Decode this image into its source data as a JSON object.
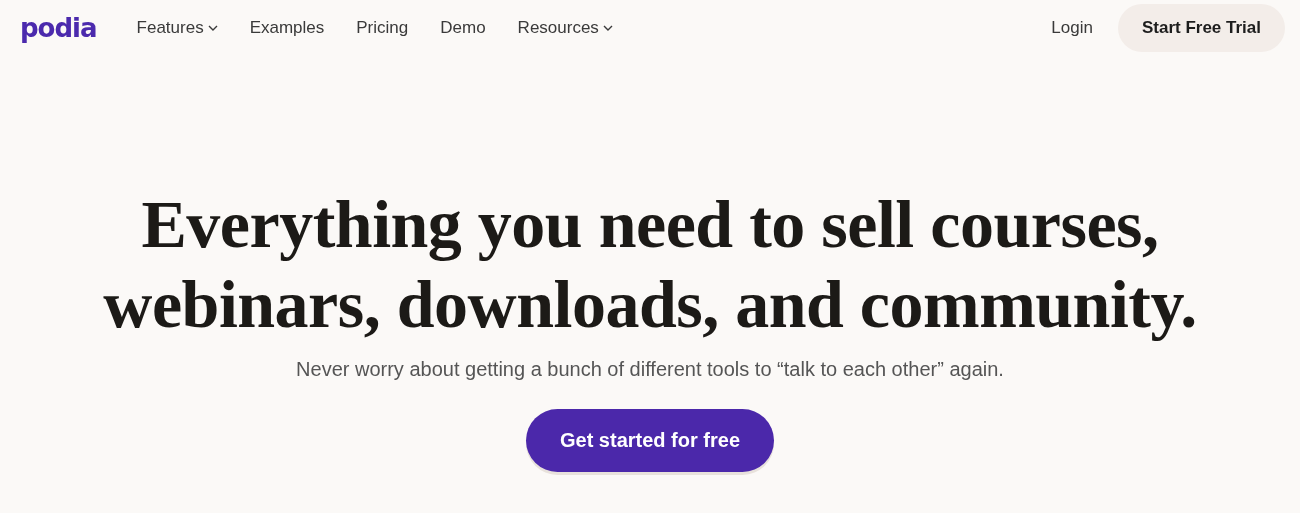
{
  "logo": "podia",
  "nav": [
    {
      "label": "Features",
      "has_menu": true
    },
    {
      "label": "Examples",
      "has_menu": false
    },
    {
      "label": "Pricing",
      "has_menu": false
    },
    {
      "label": "Demo",
      "has_menu": false
    },
    {
      "label": "Resources",
      "has_menu": true
    }
  ],
  "login": "Login",
  "trial_button": "Start Free Trial",
  "headline_lines": [
    "Everything you need to sell courses,",
    "webinars, downloads, and community."
  ],
  "subtitle": "Never worry about getting a bunch of different tools to “talk to each other” again.",
  "cta_button": "Get started for free"
}
